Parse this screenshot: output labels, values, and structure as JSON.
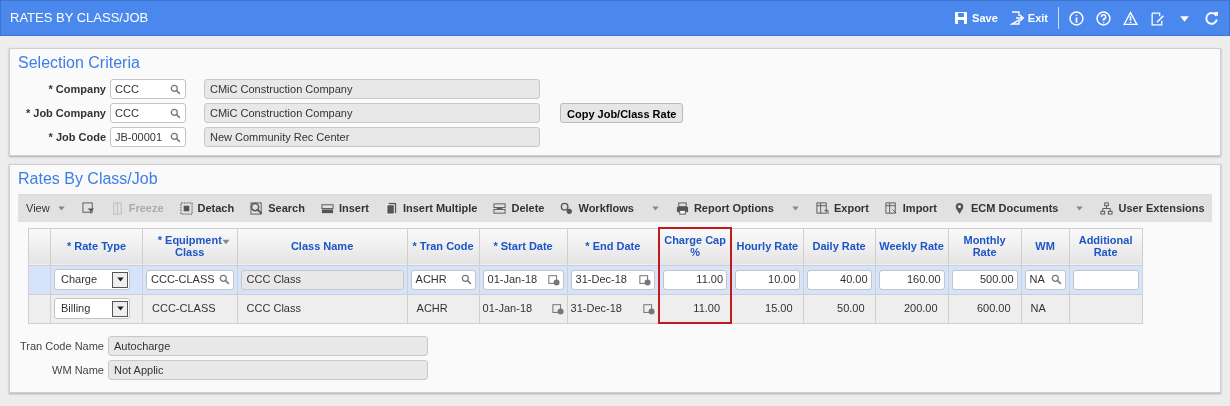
{
  "header": {
    "title": "RATES BY CLASS/JOB",
    "actions": [
      {
        "kind": "save",
        "label": "Save"
      },
      {
        "kind": "exit",
        "label": "Exit"
      }
    ]
  },
  "selection_criteria": {
    "title": "Selection Criteria",
    "fields": [
      {
        "label": "* Company",
        "code": "CCC",
        "description": "CMiC Construction Company"
      },
      {
        "label": "* Job Company",
        "code": "CCC",
        "description": "CMiC Construction Company",
        "button": "Copy Job/Class Rate"
      },
      {
        "label": "* Job Code",
        "code": "JB-00001",
        "description": "New Community Rec Center"
      }
    ]
  },
  "rates": {
    "title": "Rates By Class/Job",
    "toolbar": [
      {
        "kind": "view",
        "label": "View",
        "dropdown": true,
        "disabled": false
      },
      {
        "kind": "filter",
        "dropdown": false,
        "disabled": false
      },
      {
        "kind": "freeze",
        "label": "Freeze",
        "dropdown": false,
        "disabled": true
      },
      {
        "kind": "detach",
        "label": "Detach",
        "dropdown": false,
        "disabled": false
      },
      {
        "kind": "search",
        "label": "Search",
        "dropdown": false,
        "disabled": false
      },
      {
        "kind": "insert",
        "label": "Insert",
        "dropdown": false,
        "disabled": false
      },
      {
        "kind": "insert-multiple",
        "label": "Insert Multiple",
        "dropdown": false,
        "disabled": false
      },
      {
        "kind": "delete",
        "label": "Delete",
        "dropdown": false,
        "disabled": false
      },
      {
        "kind": "workflows",
        "label": "Workflows",
        "dropdown": true,
        "disabled": false
      },
      {
        "kind": "report",
        "label": "Report Options",
        "dropdown": true,
        "disabled": false
      },
      {
        "kind": "export",
        "label": "Export",
        "dropdown": false,
        "disabled": false
      },
      {
        "kind": "import",
        "label": "Import",
        "dropdown": false,
        "disabled": false
      },
      {
        "kind": "ecm",
        "label": "ECM Documents",
        "dropdown": true,
        "disabled": false
      },
      {
        "kind": "extensions",
        "label": "User Extensions",
        "dropdown": false,
        "disabled": false
      }
    ],
    "columns": [
      {
        "label": "* Rate Type",
        "kind": "select",
        "highlighted": false
      },
      {
        "label": "* Equipment Class",
        "kind": "lookup",
        "highlighted": false,
        "sortable": true
      },
      {
        "label": "Class Name",
        "kind": "display",
        "highlighted": false
      },
      {
        "label": "* Tran Code",
        "kind": "lookup",
        "highlighted": false
      },
      {
        "label": "* Start Date",
        "kind": "date",
        "highlighted": false
      },
      {
        "label": "* End Date",
        "kind": "date",
        "highlighted": false
      },
      {
        "label": "Charge Cap %",
        "kind": "number",
        "highlighted": true
      },
      {
        "label": "Hourly Rate",
        "kind": "number",
        "highlighted": false
      },
      {
        "label": "Daily Rate",
        "kind": "number",
        "highlighted": false
      },
      {
        "label": "Weekly Rate",
        "kind": "number",
        "highlighted": false
      },
      {
        "label": "Monthly Rate",
        "kind": "number",
        "highlighted": false
      },
      {
        "label": "WM",
        "kind": "lookup",
        "highlighted": false
      },
      {
        "label": "Additional Rate",
        "kind": "number",
        "highlighted": false
      }
    ],
    "rows": [
      {
        "selected": true,
        "cells": [
          "Charge",
          "CCC-CLASS",
          "CCC Class",
          "ACHR",
          "01-Jan-18",
          "31-Dec-18",
          "11.00",
          "10.00",
          "40.00",
          "160.00",
          "500.00",
          "NA"
        ]
      },
      {
        "selected": false,
        "cells": [
          "Billing",
          "CCC-CLASS",
          "CCC Class",
          "ACHR",
          "01-Jan-18",
          "31-Dec-18",
          "11.00",
          "15.00",
          "50.00",
          "200.00",
          "600.00",
          "NA"
        ]
      }
    ],
    "detail_fields": [
      {
        "label": "Tran Code Name",
        "value": "Autocharge"
      },
      {
        "label": "WM Name",
        "value": "Not Applic"
      }
    ]
  }
}
